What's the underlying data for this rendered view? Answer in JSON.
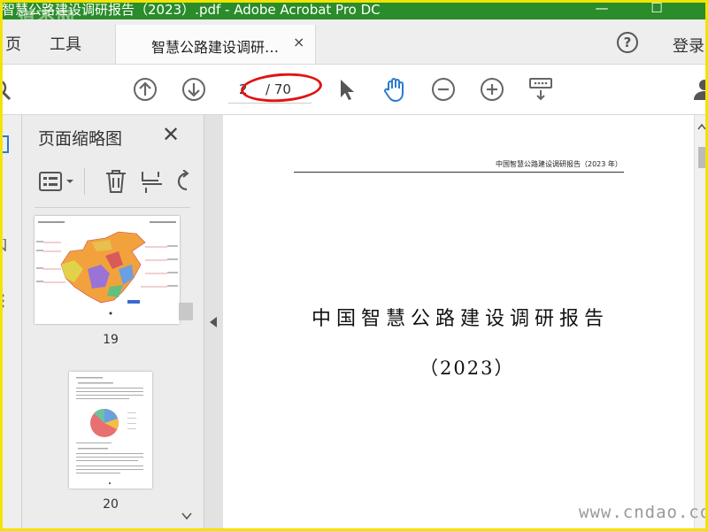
{
  "window": {
    "title": "智慧公路建设调研报告（2023）.pdf - Adobe Acrobat Pro DC",
    "title_watermark": "道不网",
    "controls": {
      "minimize": "—",
      "maximize": "☐"
    }
  },
  "tabs": {
    "nav": [
      "页",
      "工具"
    ],
    "document_tab": "智慧公路建设调研…",
    "close_glyph": "×",
    "help_glyph": "?",
    "login": "登录"
  },
  "toolbar": {
    "page_current": "2",
    "page_total": "/ 70",
    "icons": [
      "search-icon",
      "prev-page-icon",
      "next-page-icon",
      "select-arrow-icon",
      "hand-tool-icon",
      "zoom-out-icon",
      "zoom-in-icon",
      "scroll-mode-icon",
      "account-icon"
    ],
    "colors": {
      "icon": "#666666",
      "hand_active": "#2b7bd0",
      "highlight_ellipse": "#e01414"
    }
  },
  "thumbnails_panel": {
    "title": "页面缩略图",
    "close_glyph": "✕",
    "tools": [
      "options-icon",
      "delete-icon",
      "crop-icon",
      "rotate-icon"
    ],
    "items": [
      {
        "page": "19"
      },
      {
        "page": "20"
      }
    ]
  },
  "document": {
    "running_header": "中国智慧公路建设调研报告（2023 年）",
    "title": "中国智慧公路建设调研报告",
    "year": "（2023）"
  },
  "watermark": "www.cndao.com",
  "theme": {
    "titlebar": "#2a8c2a",
    "frame": "#f2e400"
  }
}
